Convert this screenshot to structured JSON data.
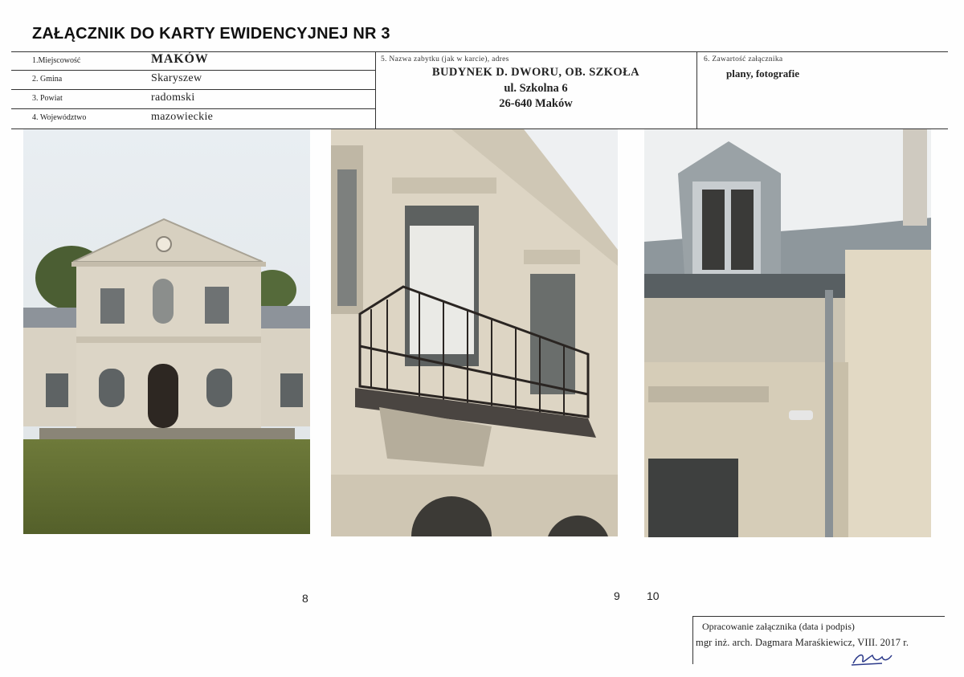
{
  "document": {
    "title": "ZAŁĄCZNIK DO KARTY EWIDENCYJNEJ NR 3"
  },
  "header": {
    "location": {
      "miejscowosc_label": "1.Miejscowość",
      "miejscowosc_value": "MAKÓW",
      "gmina_label": "2. Gmina",
      "gmina_value": "Skaryszew",
      "powiat_label": "3. Powiat",
      "powiat_value": "radomski",
      "wojewodztwo_label": "4. Województwo",
      "wojewodztwo_value": "mazowieckie"
    },
    "monument": {
      "label": "5. Nazwa zabytku (jak w karcie), adres",
      "name": "BUDYNEK D. DWORU, OB. SZKOŁA",
      "street": "ul. Szkolna 6",
      "postal": "26-640 Maków"
    },
    "contents": {
      "label": "6. Zawartość załącznika",
      "value": "plany, fotografie"
    }
  },
  "photos": [
    {
      "number": "8",
      "subject": "building-facade"
    },
    {
      "number": "9",
      "subject": "balcony-detail"
    },
    {
      "number": "10",
      "subject": "dormer-corner-detail"
    }
  ],
  "footer": {
    "label": "Opracowanie załącznika (data i podpis)",
    "author": "mgr inż. arch. Dagmara Maraśkiewicz, VIII. 2017 r."
  },
  "colors": {
    "border": "#333333",
    "text": "#1a1a1a",
    "paper": "#fefefe"
  }
}
